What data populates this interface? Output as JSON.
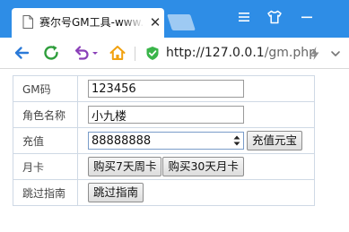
{
  "browser": {
    "tab_title": "赛尔号GM工具-www.",
    "tab_close": "✕",
    "url_host": "http://127.0.0.1",
    "url_path": "/gm.php",
    "icons": {
      "back": "back-arrow-icon",
      "reload": "reload-icon",
      "undo": "undo-icon",
      "home": "home-icon",
      "security": "shield-check-icon",
      "accelerate": "lightning-icon",
      "more": "chevron-down-icon",
      "menu": "menu-icon",
      "skin": "shirt-icon",
      "minimize": "minimize-icon"
    },
    "colors": {
      "tabstrip": "#2e8de6",
      "back": "#2b7ad8",
      "reload": "#2f9e3c",
      "undo": "#8a3fb8",
      "home": "#f1a10f",
      "shield": "#3ab54a"
    }
  },
  "form": {
    "rows": [
      {
        "label": "GM码"
      },
      {
        "label": "角色名称"
      },
      {
        "label": "充值"
      },
      {
        "label": "月卡"
      },
      {
        "label": "跳过指南"
      }
    ],
    "gm_code_value": "123456",
    "role_name_value": "小九楼",
    "recharge_value": "88888888",
    "recharge_button": "充值元宝",
    "month_card_7_button": "购买7天周卡",
    "month_card_30_button": "购买30天月卡",
    "skip_guide_button": "跳过指南"
  }
}
